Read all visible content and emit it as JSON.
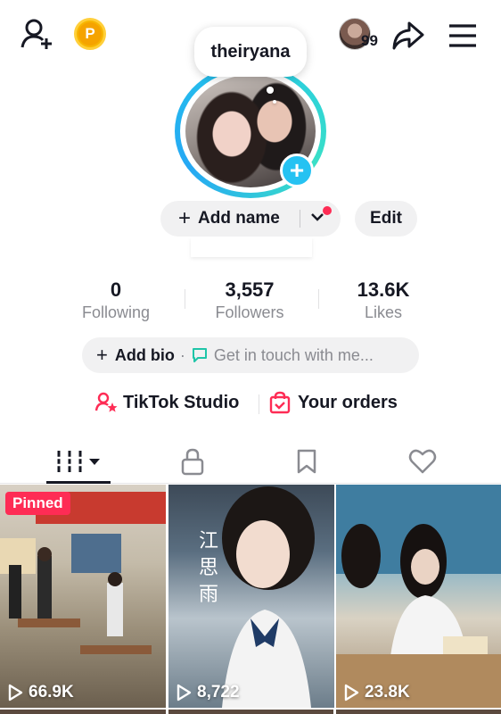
{
  "header": {
    "friends_count": "99"
  },
  "profile": {
    "username": "theiryana",
    "add_name_label": "Add name",
    "edit_label": "Edit"
  },
  "stats": {
    "following": {
      "value": "0",
      "label": "Following"
    },
    "followers": {
      "value": "3,557",
      "label": "Followers"
    },
    "likes": {
      "value": "13.6K",
      "label": "Likes"
    }
  },
  "bio": {
    "add_bio_label": "Add bio",
    "get_in_touch_label": "Get in touch with me..."
  },
  "links": {
    "studio_label": "TikTok Studio",
    "orders_label": "Your orders"
  },
  "tabs": [
    {
      "name": "videos",
      "icon": "grid-icon",
      "selected": true
    },
    {
      "name": "private",
      "icon": "lock-icon",
      "selected": false
    },
    {
      "name": "saved",
      "icon": "bookmark-icon",
      "selected": false
    },
    {
      "name": "liked",
      "icon": "heart-icon",
      "selected": false
    }
  ],
  "videos": [
    {
      "views": "66.9K",
      "pinned": true,
      "pinned_label": "Pinned"
    },
    {
      "views": "8,722",
      "pinned": false
    },
    {
      "views": "23.8K",
      "pinned": false
    }
  ],
  "colors": {
    "accent_red": "#fe2c55",
    "ring_cyan": "#25c2f2",
    "coin_gold": "#f7b500",
    "text_dark": "#161823",
    "text_muted": "#8a8b91"
  }
}
